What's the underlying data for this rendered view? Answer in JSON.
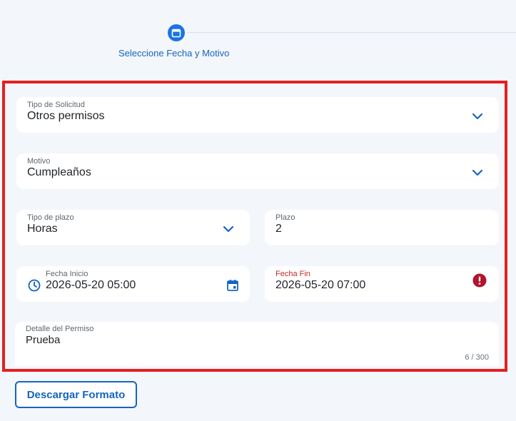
{
  "stepper": {
    "step_label": "Seleccione Fecha y Motivo",
    "step_icon": "calendar-icon"
  },
  "form": {
    "tipo_solicitud": {
      "label": "Tipo de Solicitud",
      "value": "Otros permisos"
    },
    "motivo": {
      "label": "Motivo",
      "value": "Cumpleaños"
    },
    "tipo_plazo": {
      "label": "Tipo de plazo",
      "value": "Horas"
    },
    "plazo": {
      "label": "Plazo",
      "value": "2"
    },
    "fecha_inicio": {
      "label": "Fecha Inicio",
      "value": "2026-05-20 05:00"
    },
    "fecha_fin": {
      "label": "Fecha Fin",
      "value": "2026-05-20 07:00"
    },
    "detalle": {
      "label": "Detalle del Permiso",
      "value": "Prueba",
      "counter": "6 / 300"
    }
  },
  "actions": {
    "download_label": "Descargar Formato"
  },
  "colors": {
    "accent": "#1565c0",
    "error": "#c62828",
    "highlight_frame": "#e3201f",
    "background": "#f3f6fb"
  }
}
